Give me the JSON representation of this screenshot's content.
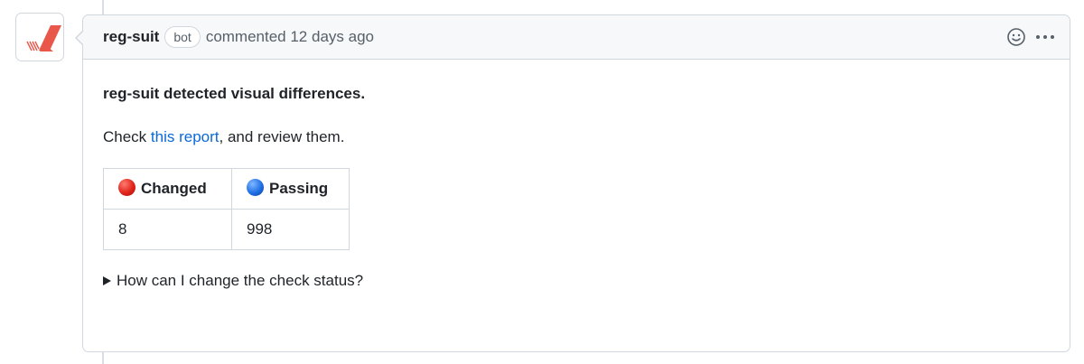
{
  "comment": {
    "author": "reg-suit",
    "badge": "bot",
    "meta": "commented 12 days ago",
    "icons": {
      "reaction": "smiley-icon",
      "menu": "kebab-menu-icon"
    },
    "avatar_icon": "reg-suit-logo",
    "colors": {
      "link": "#0969da",
      "avatar_red": "#e8574a",
      "changed": "#e0241b",
      "passing": "#1f6fe5"
    }
  },
  "body": {
    "title": "reg-suit detected visual differences.",
    "check_prefix": "Check ",
    "report_link": "this report",
    "check_suffix": ", and review them.",
    "table": {
      "headers": [
        "Changed",
        "Passing"
      ],
      "rows": [
        [
          "8",
          "998"
        ]
      ]
    },
    "details_summary": "How can I change the check status?"
  }
}
